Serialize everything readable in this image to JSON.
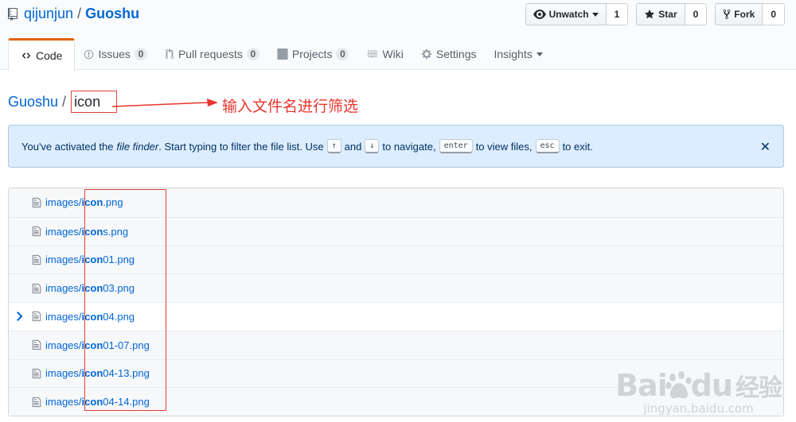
{
  "repo": {
    "owner": "qijunjun",
    "separator": "/",
    "name": "Guoshu"
  },
  "actions": [
    {
      "label": "Unwatch",
      "count": "1",
      "icon": "eye-icon"
    },
    {
      "label": "Star",
      "count": "0",
      "icon": "star-icon"
    },
    {
      "label": "Fork",
      "count": "0",
      "icon": "fork-icon"
    }
  ],
  "tabs": [
    {
      "label": "Code",
      "badge": null,
      "icon": "code-icon",
      "selected": true
    },
    {
      "label": "Issues",
      "badge": "0",
      "icon": "issue-icon"
    },
    {
      "label": "Pull requests",
      "badge": "0",
      "icon": "pull-request-icon"
    },
    {
      "label": "Projects",
      "badge": "0",
      "icon": "project-icon"
    },
    {
      "label": "Wiki",
      "badge": null,
      "icon": "wiki-icon"
    },
    {
      "label": "Settings",
      "badge": null,
      "icon": "gear-icon"
    },
    {
      "label": "Insights",
      "badge": null,
      "icon": "caret-down-icon"
    }
  ],
  "finder": {
    "repo_link": "Guoshu",
    "slash": "/",
    "query": "icon",
    "annotation": "输入文件名进行筛选"
  },
  "flash": {
    "part1": "You've activated the",
    "em": "file finder",
    "part2": ". Start typing to filter the file list. Use",
    "key_up": "↑",
    "and": "and",
    "key_down": "↓",
    "part3": "to navigate,",
    "key_enter": "enter",
    "part4": "to view files,",
    "key_esc": "esc",
    "part5": "to exit.",
    "close": "✕"
  },
  "files": [
    {
      "prefix": "images/",
      "match": "icon",
      "suffix": ".png"
    },
    {
      "prefix": "images/",
      "match": "icon",
      "suffix": "s.png"
    },
    {
      "prefix": "images/",
      "match": "icon",
      "suffix": "01.png"
    },
    {
      "prefix": "images/",
      "match": "icon",
      "suffix": "03.png"
    },
    {
      "prefix": "images/",
      "match": "icon",
      "suffix": "04.png",
      "selected": true
    },
    {
      "prefix": "images/",
      "match": "icon",
      "suffix": "01-07.png"
    },
    {
      "prefix": "images/",
      "match": "icon",
      "suffix": "04-13.png"
    },
    {
      "prefix": "images/",
      "match": "icon",
      "suffix": "04-14.png"
    }
  ],
  "watermark": {
    "main_a": "Bai",
    "main_b": "du",
    "main_c": "经验",
    "sub": "jingyan.baidu.com"
  },
  "colors": {
    "link": "#0366d6",
    "annotation": "#e8352e",
    "tab_accent": "#e36209",
    "flash_bg": "#dbedff"
  }
}
